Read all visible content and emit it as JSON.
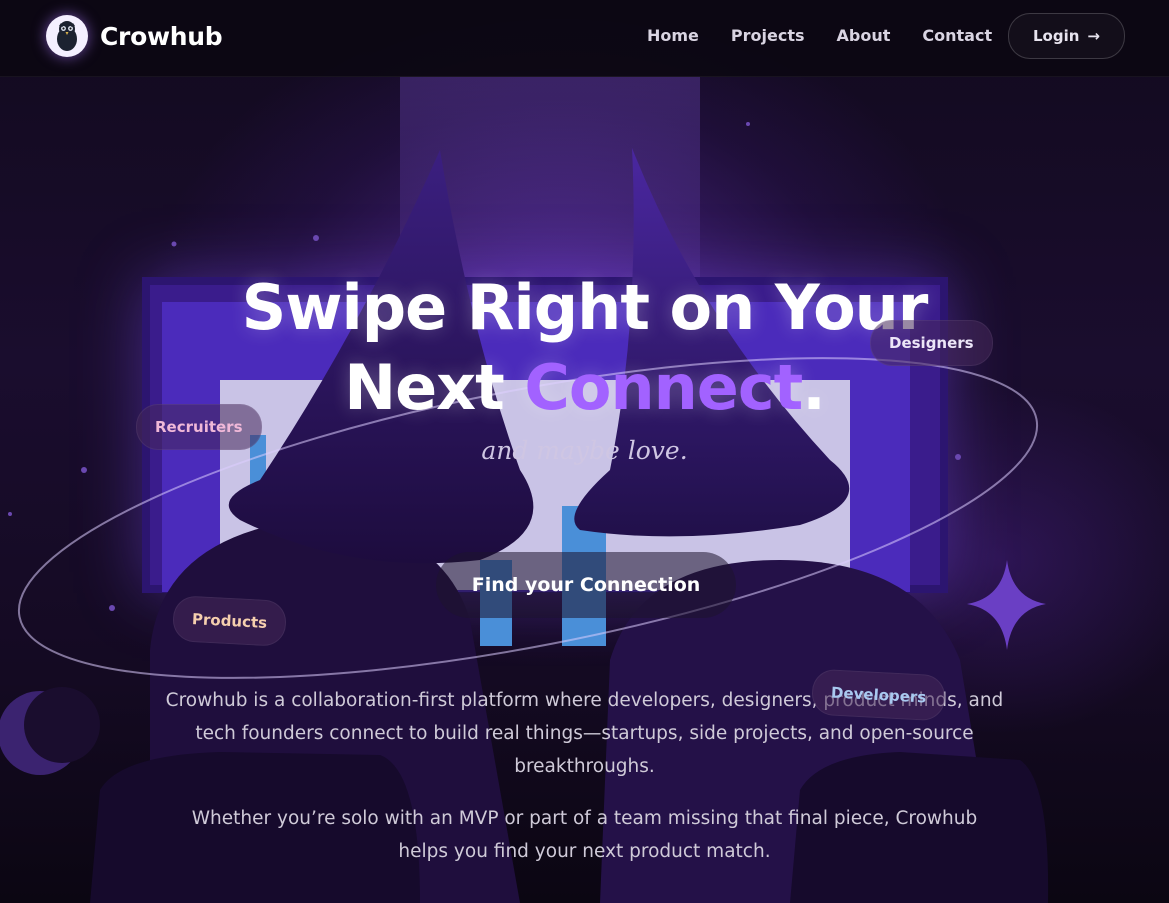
{
  "nav": {
    "brand": "Crowhub",
    "links": [
      "Home",
      "Projects",
      "About",
      "Contact"
    ],
    "login_label": "Login",
    "login_arrow": "→"
  },
  "hero": {
    "title_line1": "Swipe Right on Your",
    "title_line2_prefix": "Next ",
    "title_accent": "Connect",
    "title_suffix": ".",
    "tagline": "and maybe love.",
    "cta_label": "Find your Connection",
    "tags": [
      "Designers",
      "Recruiters",
      "Products",
      "Developers"
    ],
    "description": "Crowhub is a collaboration-first platform where developers, designers, product minds, and tech founders connect to build real things—startups, side projects, and open-source breakthroughs.",
    "description_2": "Whether you’re solo with an MVP or part of a team missing that final piece, Crowhub helps you find your next product match."
  },
  "colors": {
    "accent": "#a262ff",
    "background": "#0d0714"
  },
  "icons": {
    "logo": "crow-icon",
    "login_arrow": "arrow-right-icon",
    "sparkle": "sparkle-icon",
    "moon": "crescent-moon-icon"
  }
}
